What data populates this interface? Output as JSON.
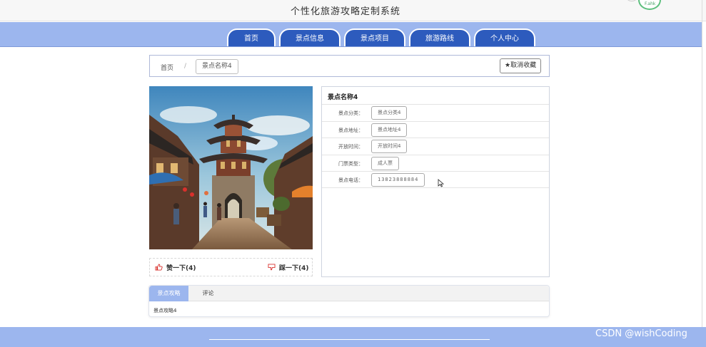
{
  "header": {
    "title": "个性化旅游攻略定制系统",
    "badge_text": "F.ahk"
  },
  "nav": {
    "tabs": [
      {
        "label": "首页"
      },
      {
        "label": "景点信息"
      },
      {
        "label": "景点项目"
      },
      {
        "label": "旅游路线"
      },
      {
        "label": "个人中心"
      }
    ]
  },
  "breadcrumb": {
    "home": "首页",
    "separator": "/",
    "current": "景点名称4"
  },
  "favorite_button": {
    "icon": "star-icon",
    "label": "取消收藏"
  },
  "detail": {
    "title": "景点名称4",
    "rows": [
      {
        "label": "景点分类：",
        "value": "景点分类4"
      },
      {
        "label": "景点地址：",
        "value": "景点地址4"
      },
      {
        "label": "开放时间：",
        "value": "开放时间4"
      },
      {
        "label": "门票类型：",
        "value": "成人票"
      },
      {
        "label": "景点电话：",
        "value": "13823888884"
      }
    ]
  },
  "votes": {
    "like": {
      "icon": "thumbs-up-icon",
      "label": "赞一下(4)"
    },
    "dislike": {
      "icon": "thumbs-down-icon",
      "label": "踩一下(4)"
    }
  },
  "tabs": {
    "items": [
      {
        "label": "景点攻略"
      },
      {
        "label": "评论"
      }
    ],
    "content": "景点攻略4"
  },
  "footer": {
    "watermark": "CSDN @wishCoding"
  },
  "colors": {
    "nav_bg": "#9cb6ee",
    "tab_bg": "#2d5bbd",
    "accent_red": "#d9302c"
  }
}
